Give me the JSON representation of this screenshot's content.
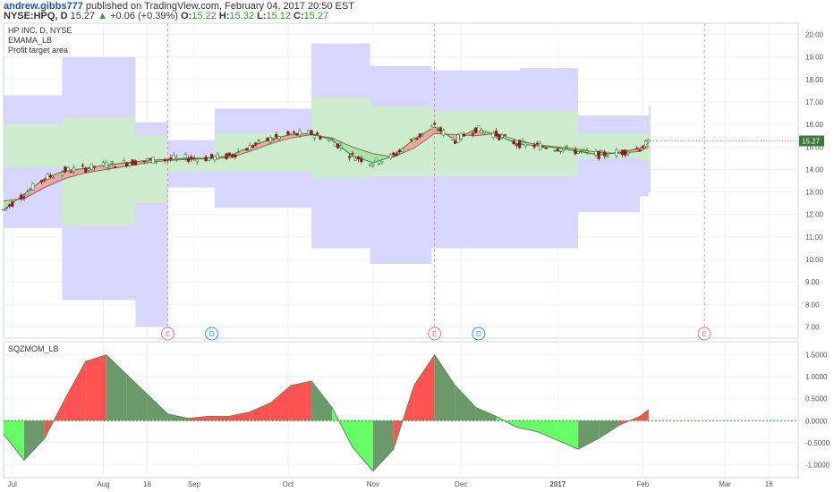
{
  "header": {
    "author": "andrew.gibbs777",
    "published_text": "published on TradingView.com, February 04, 2017 20:50 EST",
    "symbol": "NYSE:HPQ, D",
    "last": "15.27",
    "change_arrow": "▲",
    "change": "+0.06 (+0.39%)",
    "open_label": "O:",
    "open": "15.22",
    "high_label": "H:",
    "high": "15.32",
    "low_label": "L:",
    "low": "15.12",
    "close_label": "C:",
    "close": "15.27"
  },
  "legend": {
    "title": "HP INC, D, NYSE",
    "indicator1": "EMAMA_LB",
    "indicator2": "Profit target area",
    "oscillator": "SQZMOM_LB"
  },
  "price_label": "15.27",
  "colors": {
    "band_blue": "#d6d6ff",
    "band_green": "#cdeccd",
    "up_candle": "#2e7d32",
    "down_candle": "#8b1a1a",
    "ema_fill_red": "#f2a6a6",
    "ema_fill_green": "#a8e3a8",
    "mom_red": "#ff5252",
    "mom_green_light": "#66ff66",
    "mom_green_dark": "#6a9a6a",
    "mom_red_muted": "#8fbf8f",
    "earnings_marker": "#e8709a",
    "dividend_marker": "#2d9ee0"
  },
  "chart_data": [
    {
      "type": "line",
      "title": "HP INC, D, NYSE",
      "x_tick_labels": [
        "Jul",
        "Aug",
        "16",
        "Sep",
        "Oct",
        "Nov",
        "Dec",
        "2017",
        "Feb",
        "Mar",
        "16"
      ],
      "y_tick_labels": [
        "7.00",
        "8.00",
        "9.00",
        "10.00",
        "11.00",
        "12.00",
        "13.00",
        "14.00",
        "15.00",
        "16.00",
        "17.00",
        "18.00",
        "19.00",
        "20.00"
      ],
      "ylim": [
        6.5,
        20.5
      ],
      "last_price": 15.27,
      "series": [
        {
          "name": "EMAMA_LB",
          "x": [
            "Jun 28",
            "Jul 5",
            "Jul 12",
            "Jul 19",
            "Jul 26",
            "Aug 2",
            "Aug 9",
            "Aug 16",
            "Aug 23",
            "Aug 30",
            "Sep 6",
            "Sep 13",
            "Sep 20",
            "Sep 27",
            "Oct 4",
            "Oct 11",
            "Oct 18",
            "Oct 25",
            "Nov 1",
            "Nov 8",
            "Nov 15",
            "Nov 22",
            "Nov 29",
            "Dec 6",
            "Dec 13",
            "Dec 20",
            "Dec 27",
            "Jan 3",
            "Jan 10",
            "Jan 17",
            "Jan 24",
            "Jan 31",
            "Feb 3"
          ],
          "fast": [
            12.2,
            12.9,
            13.6,
            13.95,
            14.05,
            14.2,
            14.3,
            14.4,
            14.45,
            14.5,
            14.5,
            14.6,
            15.0,
            15.35,
            15.55,
            15.6,
            15.3,
            14.6,
            14.3,
            14.6,
            15.35,
            15.9,
            15.3,
            15.8,
            15.55,
            15.15,
            15.05,
            14.95,
            14.8,
            14.65,
            14.75,
            14.95,
            15.2
          ],
          "slow": [
            12.6,
            12.7,
            13.2,
            13.6,
            13.85,
            14.0,
            14.15,
            14.3,
            14.4,
            14.45,
            14.48,
            14.52,
            14.8,
            15.15,
            15.4,
            15.55,
            15.4,
            15.0,
            14.7,
            14.55,
            14.95,
            15.6,
            15.55,
            15.5,
            15.6,
            15.3,
            15.1,
            15.0,
            14.9,
            14.75,
            14.72,
            14.8,
            15.0
          ]
        }
      ],
      "profit_target_area": {
        "x": [
          "Jun 28",
          "Jul 18",
          "Aug 12",
          "Aug 23",
          "Sep 8",
          "Oct 11",
          "Oct 31",
          "Nov 21",
          "Dec 21",
          "Jan 10",
          "Jan 31",
          "Feb 3"
        ],
        "outer_upper": [
          17.3,
          19.0,
          16.1,
          15.3,
          16.7,
          19.6,
          18.6,
          18.4,
          18.5,
          16.4,
          16.4,
          16.8
        ],
        "inner_upper": [
          16.0,
          16.3,
          15.5,
          14.6,
          15.6,
          17.2,
          16.8,
          16.6,
          16.6,
          15.6,
          15.6,
          15.6
        ],
        "inner_lower": [
          14.1,
          11.5,
          12.5,
          13.9,
          13.9,
          13.6,
          13.7,
          13.7,
          13.7,
          14.5,
          14.4,
          14.1
        ],
        "outer_lower": [
          11.4,
          8.2,
          7.0,
          13.2,
          12.3,
          10.5,
          9.8,
          10.5,
          10.5,
          12.1,
          12.8,
          13.0
        ]
      },
      "events": [
        {
          "label": "E",
          "date": "Aug 23"
        },
        {
          "label": "D",
          "date": "Sep 7"
        },
        {
          "label": "E",
          "date": "Nov 22"
        },
        {
          "label": "D",
          "date": "Dec 7"
        },
        {
          "label": "E",
          "date": "Feb 22"
        }
      ]
    },
    {
      "type": "area",
      "title": "SQZMOM_LB",
      "y_tick_labels": [
        "-1.0000",
        "-0.5000",
        "0.0000",
        "0.5000",
        "1.0000",
        "1.5000"
      ],
      "ylim": [
        -1.3,
        1.8
      ],
      "series": [
        {
          "name": "SQZMOM_LB",
          "x": [
            "Jun 28",
            "Jul 5",
            "Jul 12",
            "Jul 19",
            "Jul 26",
            "Aug 2",
            "Aug 9",
            "Aug 16",
            "Aug 23",
            "Aug 30",
            "Sep 6",
            "Sep 13",
            "Sep 20",
            "Sep 27",
            "Oct 4",
            "Oct 11",
            "Oct 18",
            "Oct 25",
            "Nov 1",
            "Nov 8",
            "Nov 15",
            "Nov 22",
            "Nov 29",
            "Dec 6",
            "Dec 13",
            "Dec 20",
            "Dec 27",
            "Jan 3",
            "Jan 10",
            "Jan 17",
            "Jan 24",
            "Jan 31",
            "Feb 3"
          ],
          "values": [
            -0.3,
            -0.9,
            -0.4,
            0.5,
            1.35,
            1.5,
            1.05,
            0.6,
            0.15,
            0.05,
            0.1,
            0.1,
            0.2,
            0.4,
            0.8,
            0.9,
            0.3,
            -0.6,
            -1.15,
            -0.65,
            0.8,
            1.5,
            0.8,
            0.3,
            0.1,
            -0.15,
            -0.25,
            -0.45,
            -0.65,
            -0.4,
            -0.1,
            0.1,
            0.25
          ]
        }
      ]
    }
  ]
}
